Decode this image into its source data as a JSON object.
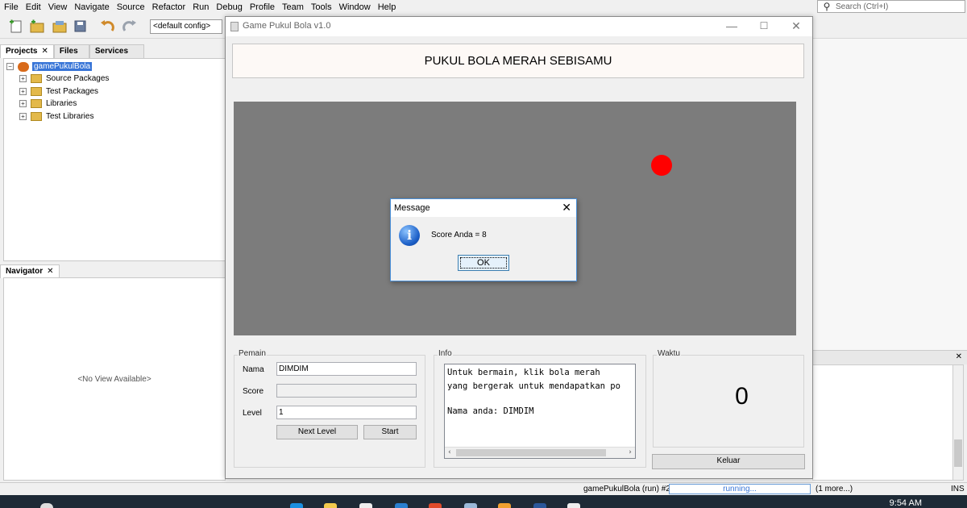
{
  "ide": {
    "menu": [
      "File",
      "Edit",
      "View",
      "Navigate",
      "Source",
      "Refactor",
      "Run",
      "Debug",
      "Profile",
      "Team",
      "Tools",
      "Window",
      "Help"
    ],
    "search_placeholder": "Search (Ctrl+I)",
    "config": "<default config>",
    "panel_tabs": [
      "Projects",
      "Files",
      "Services"
    ],
    "tree": {
      "project": "gamePukulBola",
      "children": [
        "Source Packages",
        "Test Packages",
        "Libraries",
        "Test Libraries"
      ]
    },
    "navigator": {
      "tab": "Navigator",
      "empty": "<No View Available>"
    },
    "status": {
      "run": "gamePukulBola (run) #2",
      "progress": "running...",
      "more": "(1 more...)",
      "mode": "INS"
    },
    "clock": "9:54 AM",
    "colors": {
      "selection": "#3875d7",
      "taskbar": "#1e2a36"
    }
  },
  "game": {
    "window_title": "Game Pukul Bola v1.0",
    "header": "PUKUL BOLA MERAH SEBISAMU",
    "colors": {
      "canvas": "#7c7c7c",
      "ball": "#ff0000"
    },
    "pemain": {
      "title": "Pemain",
      "nama_label": "Nama",
      "nama_value": "DIMDIM",
      "score_label": "Score",
      "score_value": "",
      "level_label": "Level",
      "level_value": "1",
      "next_level": "Next Level",
      "start": "Start"
    },
    "info": {
      "title": "Info",
      "lines": [
        "Untuk bermain, klik bola merah",
        "yang bergerak untuk mendapatkan po",
        "",
        "Nama anda: DIMDIM"
      ]
    },
    "waktu": {
      "title": "Waktu",
      "value": "0"
    },
    "keluar": "Keluar"
  },
  "dialog": {
    "title": "Message",
    "icon": "info-icon",
    "message": "Score Anda = 8",
    "ok": "OK"
  }
}
